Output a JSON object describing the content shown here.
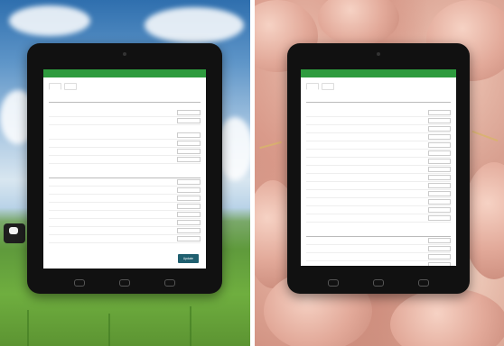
{
  "left_app": {
    "header_menu": [
      "",
      "",
      "",
      ""
    ],
    "tabs": [
      {
        "label": "",
        "active": true
      },
      {
        "label": "",
        "active": false
      }
    ],
    "columns": [
      "",
      "",
      ""
    ],
    "group_a": [
      {
        "label": "",
        "unit": "",
        "value": "",
        "input": ""
      },
      {
        "label": "",
        "unit": "",
        "value": "",
        "input": ""
      }
    ],
    "group_b": [
      {
        "label": "",
        "unit": "",
        "value": "",
        "input": ""
      },
      {
        "label": "",
        "unit": "",
        "value": "",
        "input": ""
      },
      {
        "label": "",
        "unit": "",
        "value": "",
        "input": ""
      },
      {
        "label": "",
        "unit": "",
        "value": "",
        "input": ""
      }
    ],
    "group_c_title": "",
    "group_c": [
      {
        "label": "",
        "value": "",
        "input": ""
      },
      {
        "label": "",
        "value": "",
        "input": ""
      },
      {
        "label": "",
        "value": "",
        "input": ""
      },
      {
        "label": "",
        "value": "",
        "input": ""
      },
      {
        "label": "",
        "value": "",
        "input": ""
      },
      {
        "label": "",
        "value": "",
        "input": ""
      },
      {
        "label": "",
        "value": "",
        "input": ""
      },
      {
        "label": "",
        "value": "",
        "input": ""
      }
    ],
    "update_label": "Update"
  },
  "right_app": {
    "header_menu": [
      "",
      "",
      "",
      ""
    ],
    "tabs": [
      {
        "label": "",
        "active": true
      },
      {
        "label": "",
        "active": false
      }
    ],
    "columns": [
      "",
      "",
      ""
    ],
    "group_a": [
      {
        "label": "",
        "unit": "",
        "value": "",
        "input": ""
      },
      {
        "label": "",
        "unit": "",
        "value": "",
        "input": ""
      },
      {
        "label": "",
        "unit": "",
        "value": "",
        "input": ""
      },
      {
        "label": "",
        "unit": "",
        "value": "",
        "input": ""
      },
      {
        "label": "",
        "unit": "",
        "value": "",
        "input": ""
      },
      {
        "label": "",
        "unit": "",
        "value": "",
        "input": ""
      },
      {
        "label": "",
        "unit": "",
        "value": "",
        "input": ""
      },
      {
        "label": "",
        "unit": "",
        "value": "",
        "input": ""
      },
      {
        "label": "",
        "unit": "",
        "value": "",
        "input": ""
      },
      {
        "label": "",
        "unit": "",
        "value": "",
        "input": ""
      },
      {
        "label": "",
        "unit": "",
        "value": "",
        "input": ""
      },
      {
        "label": "",
        "unit": "",
        "value": "",
        "input": ""
      },
      {
        "label": "",
        "unit": "",
        "value": "",
        "input": ""
      },
      {
        "label": "",
        "unit": "",
        "value": "",
        "input": ""
      }
    ],
    "group_b_title": "",
    "group_b": [
      {
        "label": "",
        "value": "",
        "input": ""
      },
      {
        "label": "",
        "value": "",
        "input": ""
      },
      {
        "label": "",
        "value": "",
        "input": ""
      },
      {
        "label": "",
        "value": "",
        "input": ""
      },
      {
        "label": "",
        "value": "",
        "input": ""
      }
    ]
  },
  "colors": {
    "app_bar": "#2e9b3e",
    "update_button": "#1f5f6f",
    "tablet_bezel": "#111111"
  },
  "icons": [
    "back-icon",
    "home-icon",
    "recent-apps-icon"
  ]
}
